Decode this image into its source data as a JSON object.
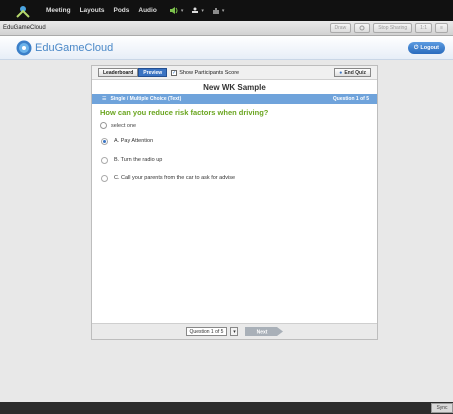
{
  "menubar": {
    "items": [
      "Meeting",
      "Layouts",
      "Pods",
      "Audio"
    ],
    "tools": {
      "speaker_caret": "▾",
      "person": "▾",
      "hand": "▾"
    }
  },
  "pod": {
    "title": "EduGameCloud",
    "buttons": {
      "draw": "Draw",
      "stop_sharing": "Stop Sharing",
      "fit": "1:1"
    }
  },
  "app": {
    "brand": "EduGameCloud",
    "logout": "Logout"
  },
  "game": {
    "leaderboard": "Leaderboard",
    "preview": "Preview",
    "show_scores": "Show Participants Score",
    "end_quiz": "End Quiz",
    "title": "New WK Sample",
    "question_type": "Single / Multiple Choice (Text)",
    "question_number": "Question 1 of 5",
    "question": "How can you reduce risk factors when driving?",
    "select_hint": "select one",
    "options": [
      {
        "label": "A. Pay Attention",
        "selected": true
      },
      {
        "label": "B. Turn the radio up",
        "selected": false
      },
      {
        "label": "C. Call your parents from the car to ask for advise",
        "selected": false
      }
    ],
    "question_select": "Question 1 of 5",
    "next": "Next"
  },
  "status": {
    "sync": "Sync"
  },
  "colors": {
    "accent": "#3a73c2",
    "question_green": "#6aa51f",
    "type_bar": "#6fa3db"
  }
}
